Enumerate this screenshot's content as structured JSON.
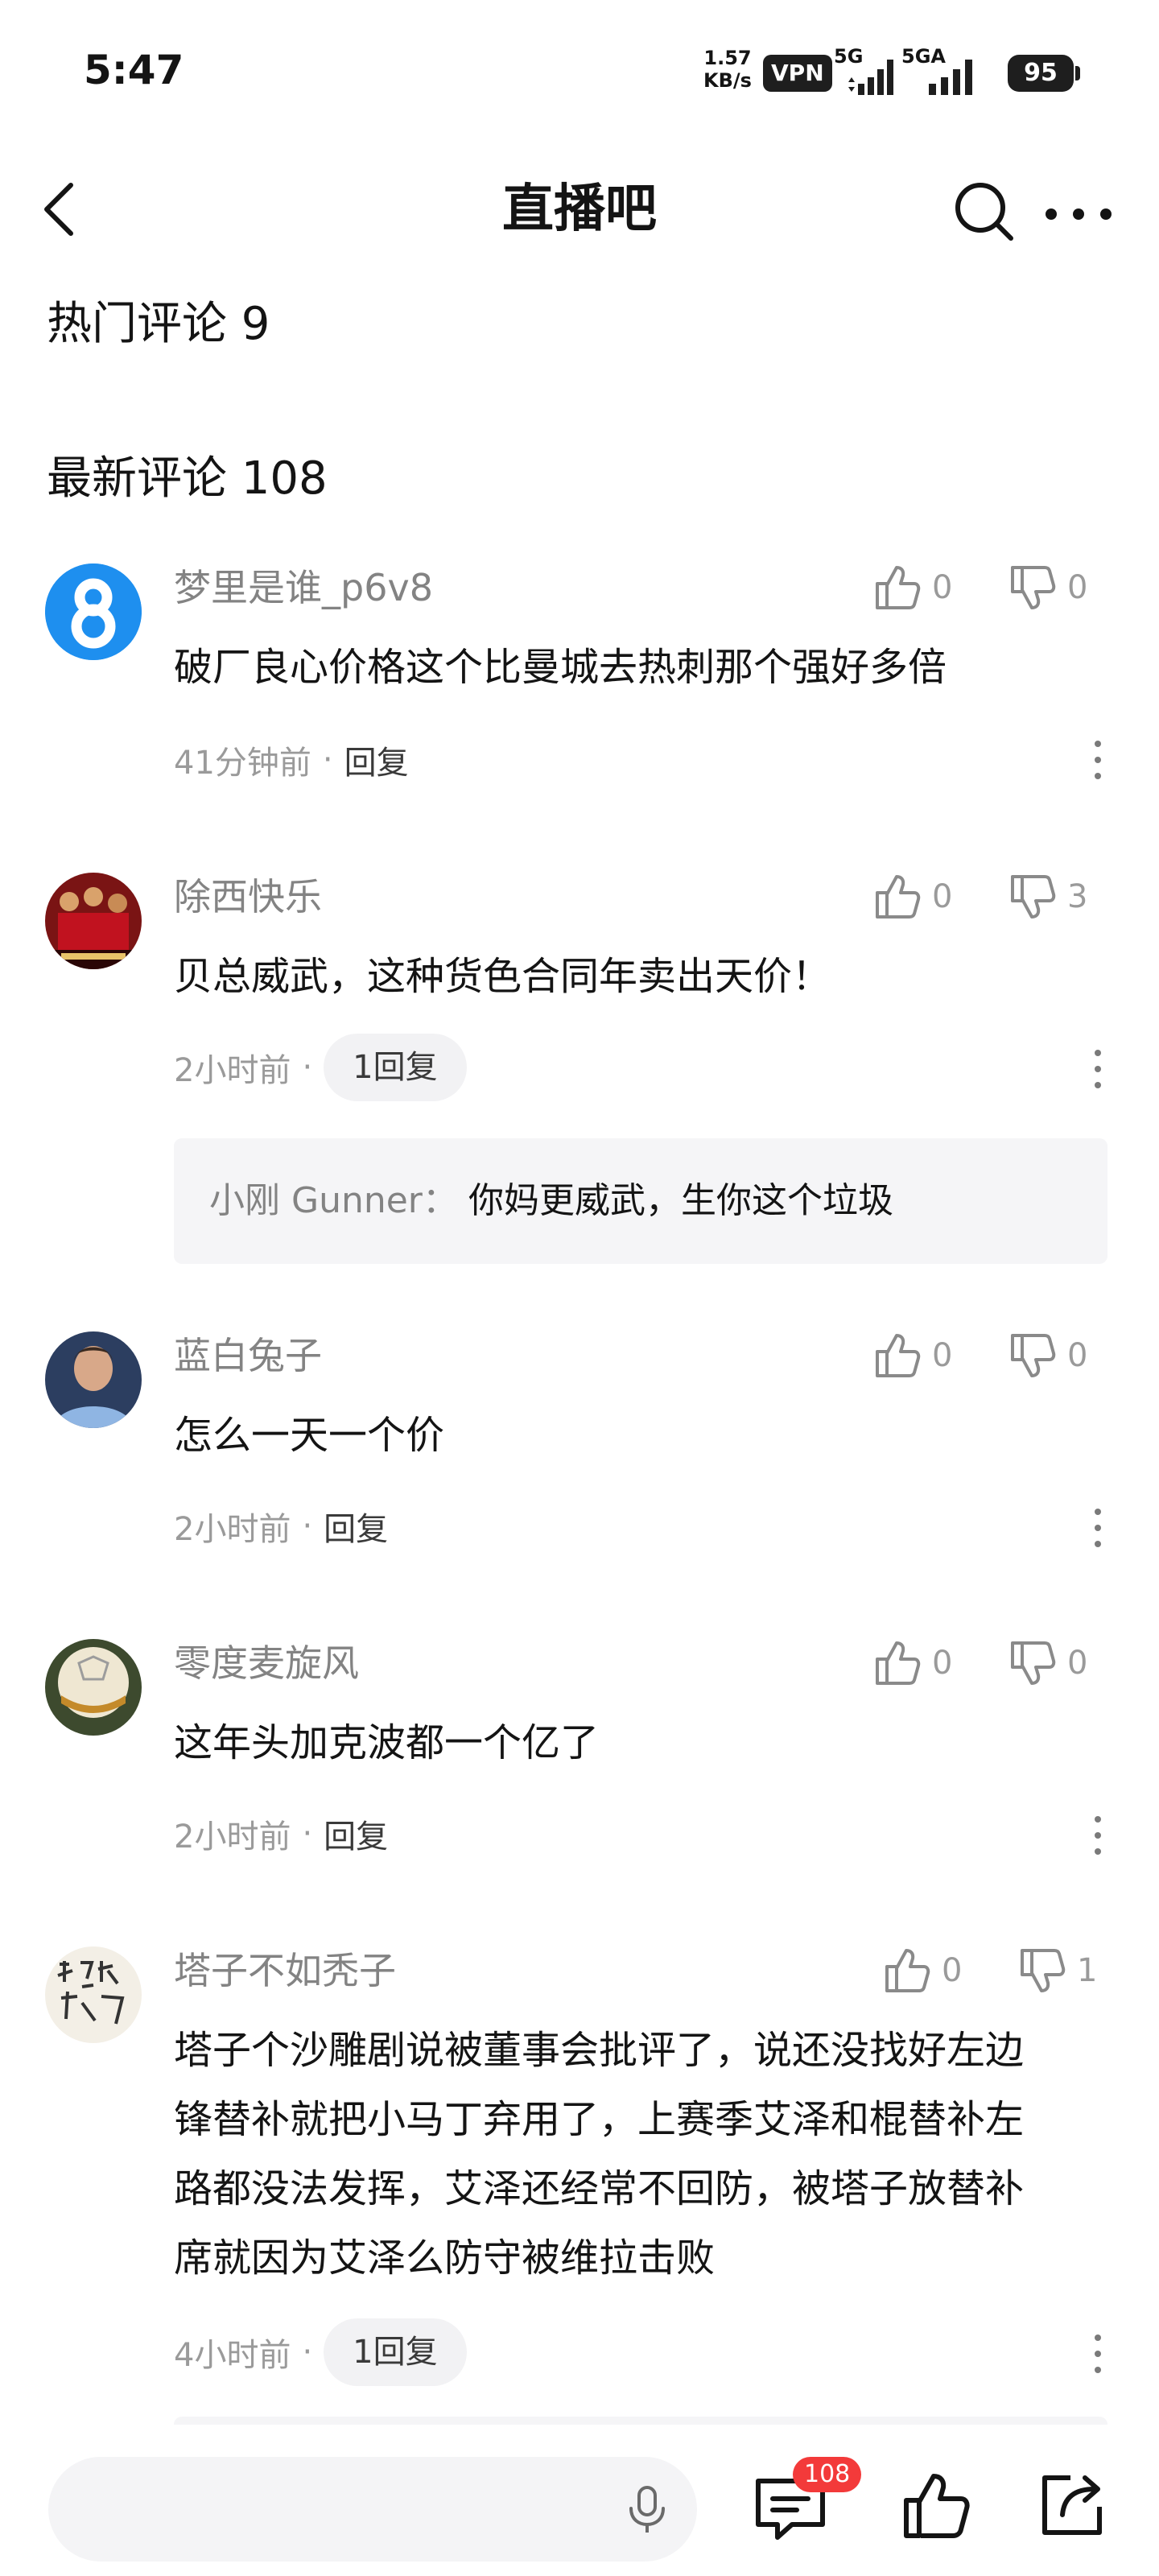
{
  "status_bar": {
    "time": "5:47",
    "net_speed_value": "1.57",
    "net_speed_unit": "KB/s",
    "vpn": "VPN",
    "signal_1": "5G",
    "signal_2": "5GA",
    "battery": "95"
  },
  "header": {
    "title": "直播吧",
    "back_icon": "chevron-left-icon",
    "search_icon": "search-icon",
    "more_icon": "more-horizontal-icon"
  },
  "sections": {
    "hot_comments": "热门评论 9",
    "latest_comments": "最新评论 108"
  },
  "comments": [
    {
      "username": "梦里是谁_p6v8",
      "likes": "0",
      "dislikes": "0",
      "content": "破厂良心价格这个比曼城去热刺那个强好多倍",
      "time": "41分钟前",
      "reply_label": "回复"
    },
    {
      "username": "除西快乐",
      "likes": "0",
      "dislikes": "3",
      "content": "贝总威武，这种货色合同年卖出天价！",
      "time": "2小时前",
      "reply_label": "1回复",
      "sub_reply": {
        "author": "小刚 Gunner：",
        "text": "你妈更威武，生你这个垃圾"
      }
    },
    {
      "username": "蓝白兔子",
      "likes": "0",
      "dislikes": "0",
      "content": "怎么一天一个价",
      "time": "2小时前",
      "reply_label": "回复"
    },
    {
      "username": "零度麦旋风",
      "likes": "0",
      "dislikes": "0",
      "content": "这年头加克波都一个亿了",
      "time": "2小时前",
      "reply_label": "回复"
    },
    {
      "username": "塔子不如秃子",
      "likes": "0",
      "dislikes": "1",
      "content_lines": [
        "塔子个沙雕剧说被董事会批评了，说还没找好左边",
        "锋替补就把小马丁弃用了，上赛季艾泽和棍替补左",
        "路都没法发挥，艾泽还经常不回防，被塔子放替补",
        "席就因为艾泽么防守被维拉击败"
      ],
      "time": "4小时前",
      "reply_label": "1回复"
    }
  ],
  "bottom_bar": {
    "input_placeholder": "",
    "comment_count": "108",
    "mic_icon": "microphone-icon",
    "comments_icon": "comment-bubble-icon",
    "like_icon": "thumbs-up-icon",
    "share_icon": "share-icon"
  },
  "colors": {
    "text_primary": "#141414",
    "text_secondary": "#838383",
    "text_muted": "#9a9a9a",
    "badge_red": "#f33a3a",
    "avatar_blue": "#1e8fef"
  }
}
